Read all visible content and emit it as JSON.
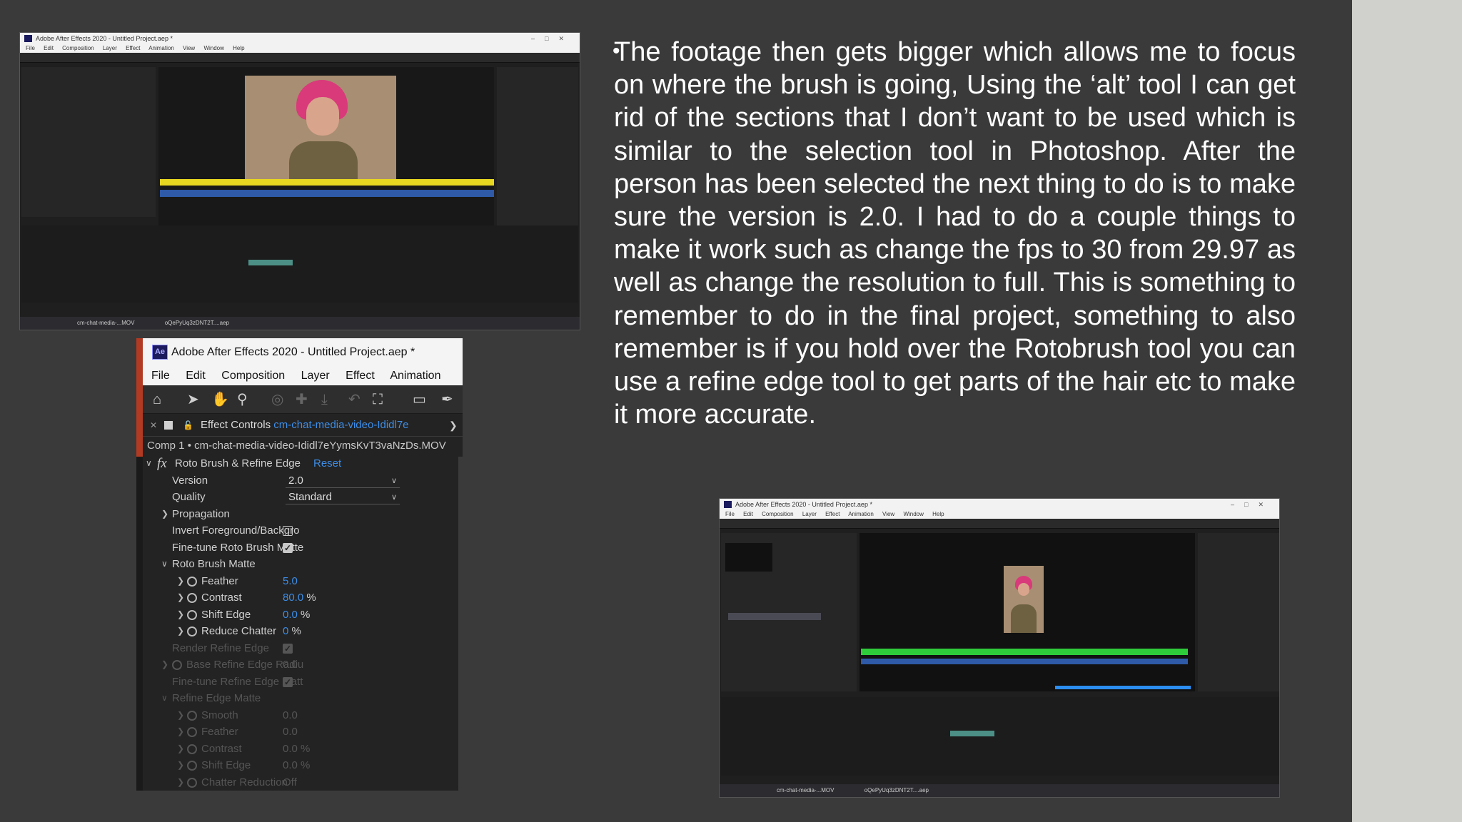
{
  "body_text": "The footage then gets bigger which allows me to focus on where the brush is going, Using the ‘alt’ tool I can get rid of the sections that I don’t want to be used which is similar to the selection tool in Photoshop. After the person has been selected the next thing to do is to make sure the version is 2.0. I had to do a couple things to make it work such as change the fps to 30 from 29.97 as well as change the resolution to full. This is something to remember to do in the final project, something to also remember is if you hold over the Rotobrush tool you can use a refine edge tool to get parts of the hair etc  to make it more accurate.",
  "colors": {
    "background": "#3a3a3b",
    "accent_blue": "#3d8ee8",
    "app_red": "#b23a22"
  },
  "screenshot_top": {
    "title": "Adobe After Effects 2020 - Untitled Project.aep *",
    "menu": [
      "File",
      "Edit",
      "Composition",
      "Layer",
      "Effect",
      "Animation",
      "View",
      "Window",
      "Help"
    ],
    "taskbar": [
      "cm-chat-media-...MOV",
      "oQePyUq3zDNT2T....aep"
    ]
  },
  "screenshot_bottom": {
    "title": "Adobe After Effects 2020 - Untitled Project.aep *",
    "menu": [
      "File",
      "Edit",
      "Composition",
      "Layer",
      "Effect",
      "Animation",
      "View",
      "Window",
      "Help"
    ],
    "taskbar": [
      "cm-chat-media-...MOV",
      "oQePyUq3zDNT2T....aep"
    ]
  },
  "effect_controls": {
    "app_logo": "Ae",
    "title": "Adobe After Effects 2020 - Untitled Project.aep *",
    "menu": [
      "File",
      "Edit",
      "Composition",
      "Layer",
      "Effect",
      "Animation"
    ],
    "tab_title": "Effect Controls",
    "tab_source": "cm-chat-media-video-Ididl7e",
    "breadcrumb": "Comp 1 • cm-chat-media-video-Ididl7eYymsKvT3vaNzDs.MOV",
    "effect_name": "Roto Brush & Refine Edge",
    "reset_label": "Reset",
    "fx_label": "fx",
    "rows": {
      "version_label": "Version",
      "version_value": "2.0",
      "quality_label": "Quality",
      "quality_value": "Standard",
      "propagation": "Propagation",
      "invert_fg": "Invert Foreground/Backgro",
      "fine_tune": "Fine-tune Roto Brush Matte",
      "roto_matte": "Roto Brush Matte",
      "feather_label": "Feather",
      "feather_value": "5.0",
      "contrast_label": "Contrast",
      "contrast_value": "80.0",
      "contrast_unit": "%",
      "shift_label": "Shift Edge",
      "shift_value": "0.0",
      "shift_unit": "%",
      "chatter_label": "Reduce Chatter",
      "chatter_value": "0",
      "chatter_unit": "%",
      "render_refine": "Render Refine Edge",
      "base_radius": "Base Refine Edge Radiu",
      "base_radius_value": "0.0",
      "fine_tune_refine": "Fine-tune Refine Edge Matt",
      "refine_matte": "Refine Edge Matte",
      "smooth_label": "Smooth",
      "smooth_value": "0.0",
      "feather2_label": "Feather",
      "feather2_value": "0.0",
      "contrast2_label": "Contrast",
      "contrast2_value": "0.0",
      "contrast2_unit": "%",
      "shift2_label": "Shift Edge",
      "shift2_value": "0.0",
      "shift2_unit": "%",
      "chatter2_label": "Chatter Reduction",
      "chatter2_value": "Off"
    }
  }
}
